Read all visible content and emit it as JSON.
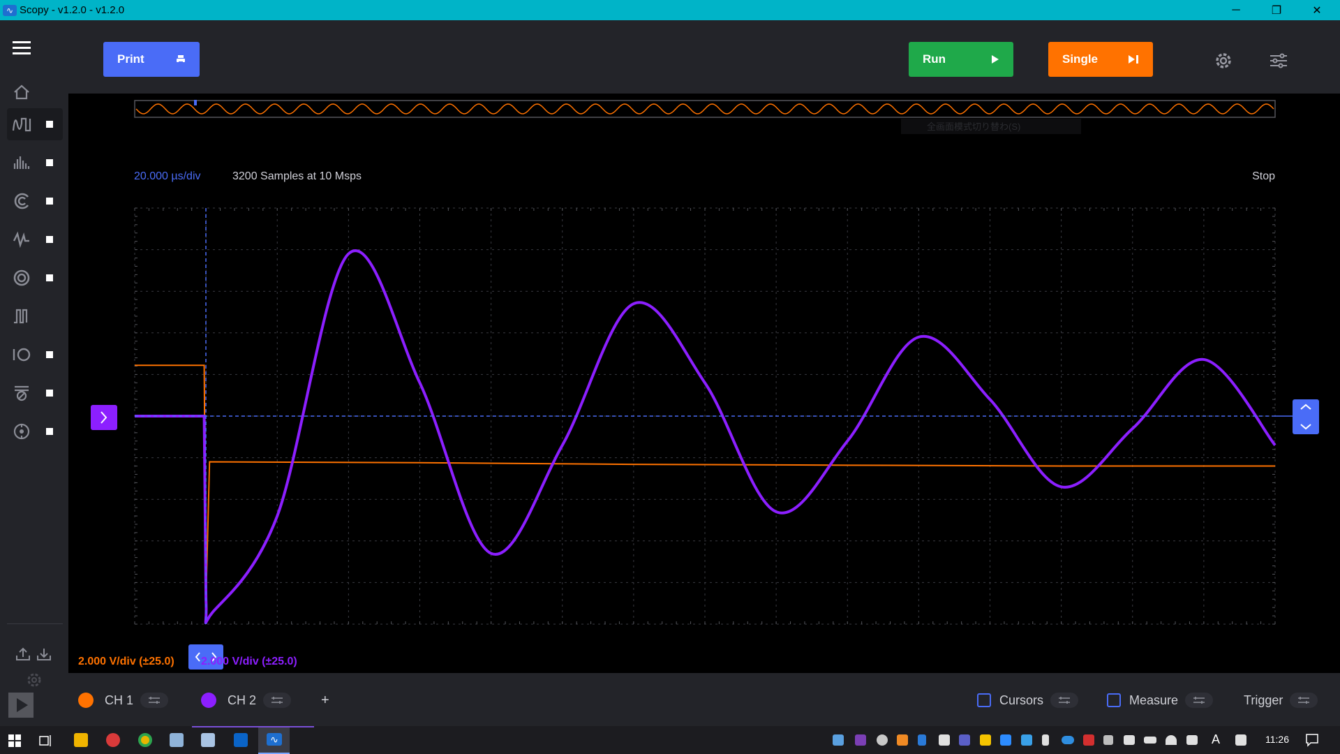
{
  "window": {
    "title": "Scopy - v1.2.0 - v1.2.0",
    "minimize": "─",
    "restore": "❐",
    "close": "✕"
  },
  "toolbar": {
    "print_label": "Print",
    "run_label": "Run",
    "single_label": "Single",
    "colors": {
      "print": "#4a6cf7",
      "run": "#1fa94a",
      "single": "#ff7200"
    }
  },
  "plot": {
    "time_base": "20.000 µs/div",
    "samples_info": "3200 Samples at 10 Msps",
    "status": "Stop",
    "overlay_text": "全画面模式切り替わ(S)",
    "ch1_scale": "2.000 V/div (±25.0)",
    "ch2_scale": "2.000 V/div (±25.0)"
  },
  "channels": [
    {
      "name": "CH 1",
      "color": "#ff7200"
    },
    {
      "name": "CH 2",
      "color": "#8c1fff"
    }
  ],
  "bottom": {
    "add": "+",
    "cursors_label": "Cursors",
    "measure_label": "Measure",
    "trigger_label": "Trigger"
  },
  "taskbar": {
    "time": "11:26"
  },
  "chart_data": {
    "type": "line",
    "xlabel": "",
    "ylabel": "",
    "xlim": [
      0,
      320
    ],
    "ylim": [
      -25,
      25
    ],
    "x_unit": "µs",
    "y_unit": "V",
    "grid": true,
    "divisions_x": 16,
    "divisions_y": 10,
    "series": [
      {
        "name": "CH 1",
        "color": "#ff7200",
        "x": [
          0,
          19.5,
          20,
          21,
          80,
          140,
          200,
          260,
          320
        ],
        "y": [
          6.1,
          6.1,
          -22,
          -5.5,
          -5.6,
          -5.8,
          -5.9,
          -6.0,
          -6.0
        ]
      },
      {
        "name": "CH 2",
        "color": "#8c1fff",
        "x": [
          0,
          19.5,
          20,
          22,
          40,
          60,
          80,
          100,
          120,
          140,
          160,
          180,
          200,
          220,
          240,
          260,
          280,
          300,
          320
        ],
        "y": [
          0,
          0,
          -22,
          -23.5,
          -12,
          19.5,
          4,
          -16.5,
          -3.5,
          13.5,
          4,
          -11.5,
          -3,
          9.5,
          2,
          -8.5,
          -1.5,
          6.8,
          -3.5
        ]
      }
    ]
  }
}
